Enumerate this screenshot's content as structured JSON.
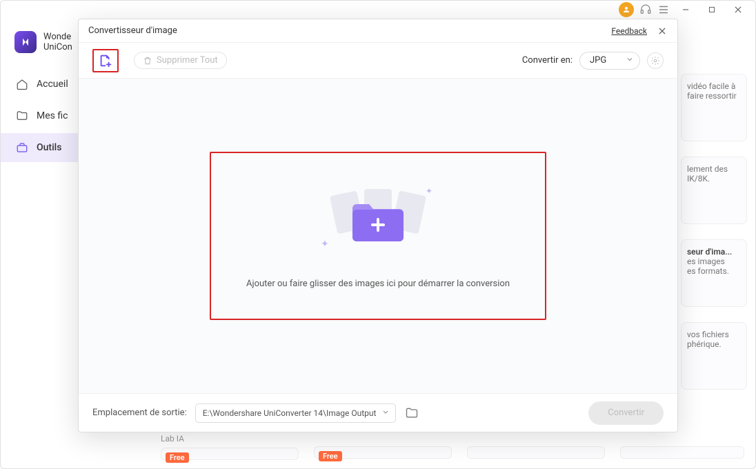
{
  "brand": {
    "line1": "Wonde",
    "line2": "UniCon"
  },
  "sidebar": {
    "items": [
      {
        "label": "Accueil"
      },
      {
        "label": "Mes fic"
      },
      {
        "label": "Outils"
      }
    ]
  },
  "peek": [
    {
      "l1": "vidéo facile à",
      "l2": "faire ressortir"
    },
    {
      "l1": "lement des",
      "l2": "IK/8K."
    },
    {
      "l1": "seur d'ima...",
      "l2": "es images",
      "l3": "es formats."
    },
    {
      "l1": "vos fichiers",
      "l2": "phérique."
    }
  ],
  "lab": "Lab IA",
  "free": "Free",
  "modal": {
    "title": "Convertisseur d'image",
    "feedback": "Feedback",
    "delete_all": "Supprimer Tout",
    "convert_in": "Convertir en:",
    "format": "JPG",
    "drop_text": "Ajouter ou faire glisser des images ici pour démarrer la conversion",
    "out_label": "Emplacement de sortie:",
    "out_path": "E:\\Wondershare UniConverter 14\\Image Output",
    "convert": "Convertir"
  }
}
